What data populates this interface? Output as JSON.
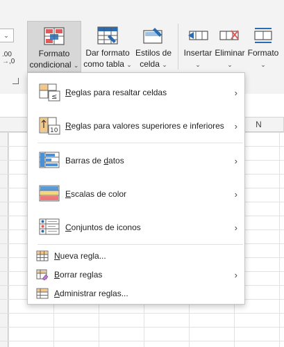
{
  "ribbon": {
    "number_format_dropdown": "⌄",
    "decimal_label": ".00",
    "decimal_label2": ",0",
    "buttons": [
      {
        "line1": "Formato",
        "line2": "condicional"
      },
      {
        "line1": "Dar formato",
        "line2": "como tabla"
      },
      {
        "line1": "Estilos de",
        "line2": "celda"
      },
      {
        "line1": "Insertar",
        "line2": ""
      },
      {
        "line1": "Eliminar",
        "line2": ""
      },
      {
        "line1": "Formato",
        "line2": ""
      }
    ]
  },
  "grid": {
    "visible_column_header": "N"
  },
  "menu": {
    "items": [
      {
        "label_pre": "",
        "label_ul": "R",
        "label_post": "eglas para resaltar celdas",
        "has_submenu": true
      },
      {
        "label_pre": "",
        "label_ul": "R",
        "label_post": "eglas para valores superiores e inferiores",
        "has_submenu": true
      },
      {
        "label_pre": "Barras de ",
        "label_ul": "d",
        "label_post": "atos",
        "has_submenu": true
      },
      {
        "label_pre": "",
        "label_ul": "E",
        "label_post": "scalas de color",
        "has_submenu": true
      },
      {
        "label_pre": "",
        "label_ul": "C",
        "label_post": "onjuntos de iconos",
        "has_submenu": true
      },
      {
        "label_pre": "",
        "label_ul": "N",
        "label_post": "ueva regla...",
        "has_submenu": false
      },
      {
        "label_pre": "",
        "label_ul": "B",
        "label_post": "orrar reglas",
        "has_submenu": true
      },
      {
        "label_pre": "",
        "label_ul": "A",
        "label_post": "dministrar reglas...",
        "has_submenu": false
      }
    ],
    "submenu_arrow": "›",
    "icon_text_top10": "10",
    "icon_text_lte": "≤"
  },
  "colors": {
    "menu_bg": "#ffffff",
    "ribbon_bg": "#f3f3f3",
    "pressed_button": "#d7d7d7",
    "accent_blue": "#2b6cb0",
    "accent_red": "#e05a5a"
  }
}
